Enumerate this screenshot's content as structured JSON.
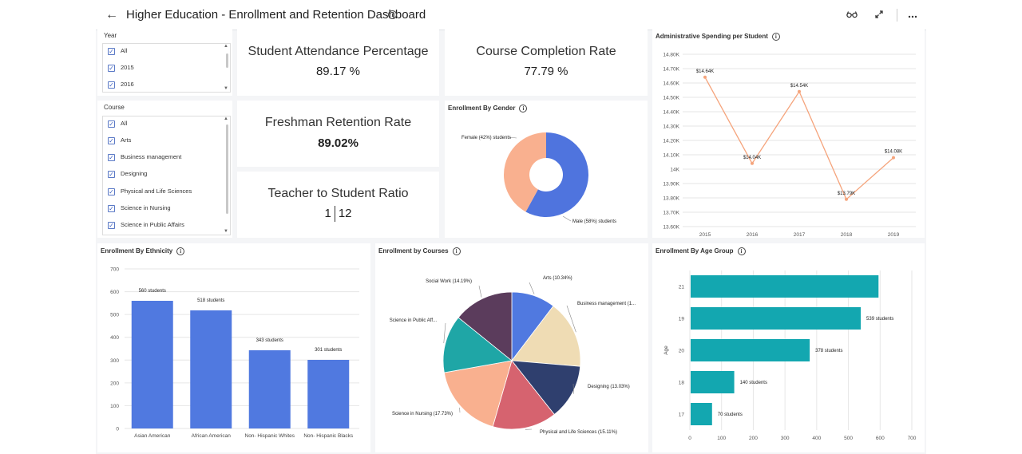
{
  "header": {
    "back_icon": "arrow-left-icon",
    "title": "Higher Education - Enrollment and Retention Dashboard",
    "info_icon": "info-icon",
    "actions": [
      {
        "name": "glasses-icon",
        "glyph": "👓"
      },
      {
        "name": "expand-icon",
        "glyph": "⤢"
      },
      {
        "name": "more-icon",
        "glyph": "⋯"
      }
    ]
  },
  "filters": {
    "year": {
      "label": "Year",
      "items": [
        "All",
        "2015",
        "2016"
      ]
    },
    "course": {
      "label": "Course",
      "items": [
        "All",
        "Arts",
        "Business management",
        "Designing",
        "Physical and Life Sciences",
        "Science in Nursing",
        "Science in Public Affairs"
      ]
    }
  },
  "kpis": {
    "attendance": {
      "label": "Student Attendance Percentage",
      "value": "89.17 %"
    },
    "completion": {
      "label": "Course Completion Rate",
      "value": "77.79 %"
    },
    "retention": {
      "label": "Freshman Retention Rate",
      "value": "89.02%"
    },
    "ratio": {
      "label": "Teacher to Student Ratio",
      "left": "1",
      "right": "12"
    }
  },
  "cards": {
    "spending": "Administrative Spending per Student",
    "gender": "Enrollment By Gender",
    "ethnicity": "Enrollment By Ethnicity",
    "courses": "Enrollment by Courses",
    "age": "Enrollment By Age Group"
  },
  "chart_data": [
    {
      "id": "spending",
      "type": "line",
      "title": "Administrative Spending per Student",
      "x": [
        "2015",
        "2016",
        "2017",
        "2018",
        "2019"
      ],
      "values": [
        14640,
        14040,
        14540,
        13790,
        14080
      ],
      "data_labels": [
        "$14.64K",
        "$14.04K",
        "$14.54K",
        "$13.79K",
        "$14.08K"
      ],
      "y_ticks": [
        "13.60K",
        "13.70K",
        "13.80K",
        "13.90K",
        "14K",
        "14.10K",
        "14.20K",
        "14.30K",
        "14.40K",
        "14.50K",
        "14.60K",
        "14.70K",
        "14.80K"
      ],
      "ylim": [
        13600,
        14800
      ],
      "color": "#f5a47c"
    },
    {
      "id": "gender",
      "type": "pie",
      "title": "Enrollment By Gender",
      "slices": [
        {
          "label": "Male (58%) students",
          "value": 58,
          "color": "#4f74de"
        },
        {
          "label": "Female (42%) students",
          "value": 42,
          "color": "#f9b08f"
        }
      ]
    },
    {
      "id": "ethnicity",
      "type": "bar",
      "title": "Enrollment By Ethnicity",
      "categories": [
        "Asian American",
        "African American",
        "Non- Hispanic Whites",
        "Non- Hispanic Blacks"
      ],
      "values": [
        560,
        518,
        343,
        301
      ],
      "data_labels": [
        "560 students",
        "518 students",
        "343 students",
        "301 students"
      ],
      "y_ticks": [
        "0",
        "100",
        "200",
        "300",
        "400",
        "500",
        "600",
        "700"
      ],
      "ylim": [
        0,
        700
      ],
      "color": "#5079e0"
    },
    {
      "id": "courses",
      "type": "pie",
      "title": "Enrollment by Courses",
      "slices": [
        {
          "label": "Arts (10.34%)",
          "value": 10.34,
          "color": "#5079e0"
        },
        {
          "label": "Business management (1...",
          "value": 15.99,
          "color": "#efdcb4"
        },
        {
          "label": "Designing (13.03%)",
          "value": 13.03,
          "color": "#2f3f6e"
        },
        {
          "label": "Physical and Life Sciences (15.11%)",
          "value": 15.11,
          "color": "#d6636f"
        },
        {
          "label": "Science in Nursing (17.73%)",
          "value": 17.73,
          "color": "#f9b08f"
        },
        {
          "label": "Science in Public Aff...",
          "value": 13.61,
          "color": "#1fa6a6"
        },
        {
          "label": "Social Work (14.19%)",
          "value": 14.19,
          "color": "#5b3c5c"
        }
      ]
    },
    {
      "id": "age",
      "type": "bar",
      "orientation": "horizontal",
      "title": "Enrollment By Age Group",
      "categories": [
        "21",
        "19",
        "20",
        "18",
        "17"
      ],
      "values": [
        595,
        539,
        378,
        140,
        70
      ],
      "data_labels": [
        "",
        "539 students",
        "378 students",
        "140 students",
        "70 students"
      ],
      "x_ticks": [
        "0",
        "100",
        "200",
        "300",
        "400",
        "500",
        "600",
        "700"
      ],
      "xlim": [
        0,
        700
      ],
      "ylabel": "Age",
      "color": "#13a7b0"
    }
  ]
}
